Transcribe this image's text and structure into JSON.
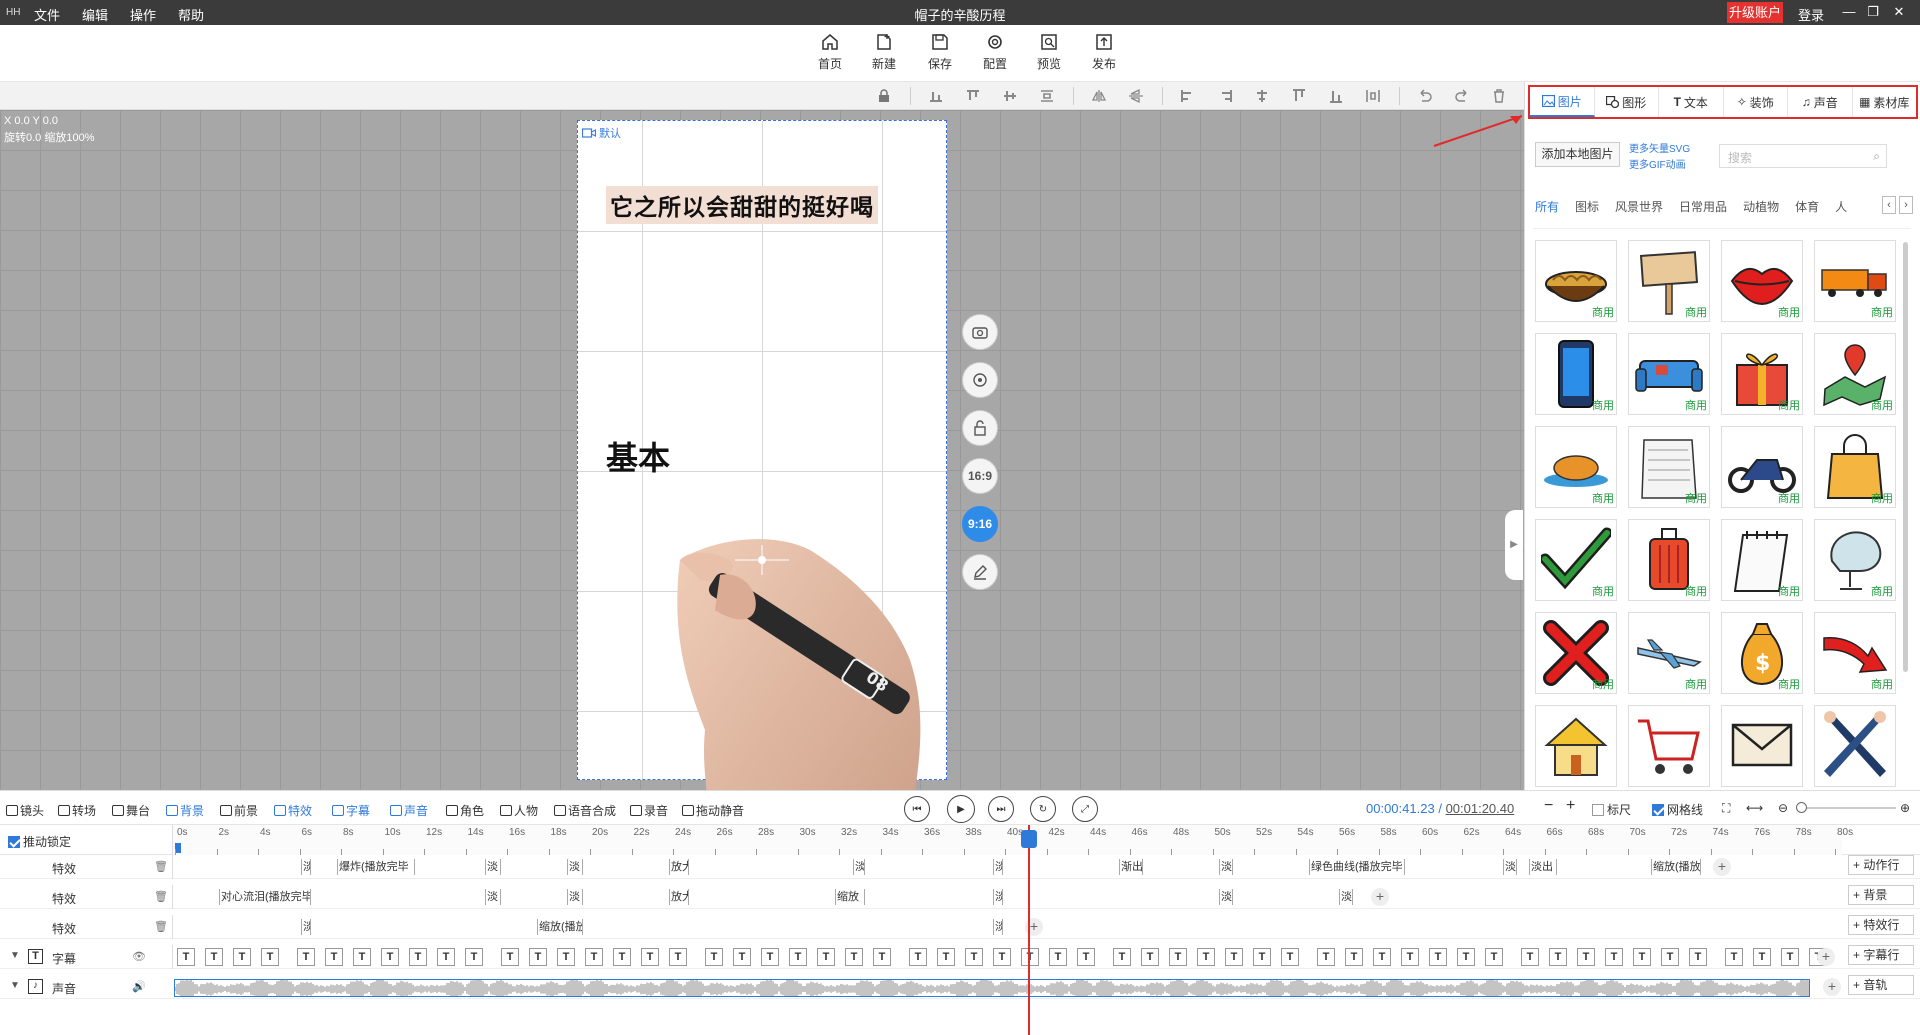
{
  "titlebar": {
    "logo": "HH",
    "menu": [
      "文件",
      "编辑",
      "操作",
      "帮助"
    ],
    "title": "帽子的辛酸历程",
    "upgrade": "升级账户",
    "login": "登录"
  },
  "toolbar": {
    "items": [
      "首页",
      "新建",
      "保存",
      "配置",
      "预览",
      "发布"
    ]
  },
  "canvas": {
    "coords": "X 0.0 Y 0.0",
    "rotate_zoom": "旋转0.0 缩放100%",
    "stage_tag": "默认",
    "text_line1": "它之所以会甜甜的挺好喝",
    "text_line2": "基本",
    "pen_label": "08",
    "side_buttons": {
      "ratio_169": "16:9",
      "ratio_916": "9:16"
    }
  },
  "right_panel": {
    "tabs": [
      "图片",
      "图形",
      "文本",
      "装饰",
      "声音",
      "素材库"
    ],
    "add_local": "添加本地图片",
    "link_svg": "更多矢量SVG",
    "link_gif": "更多GIF动画",
    "search_placeholder": "搜索",
    "categories": [
      "所有",
      "图标",
      "风景世界",
      "日常用品",
      "动植物",
      "体育",
      "人"
    ],
    "tag": "商用",
    "assets": [
      "noodles",
      "sign",
      "lips",
      "truck",
      "phone",
      "sofa",
      "gift",
      "map-pin",
      "roast-chicken",
      "paper-stack",
      "motorcycle",
      "shopping-bag",
      "check",
      "suitcase",
      "notepad",
      "chair",
      "cross",
      "airplane",
      "money-bag",
      "red-arrow",
      "house",
      "shopping-cart",
      "envelope",
      "crossed-arms"
    ]
  },
  "timeline": {
    "tools": [
      "镜头",
      "转场",
      "舞台",
      "背景",
      "前景",
      "特效",
      "字幕",
      "声音",
      "角色",
      "人物",
      "语音合成",
      "录音",
      "拖动静音"
    ],
    "current_time": "00:00:41.23",
    "separator": "/",
    "total_time": "00:01:20.40",
    "ruler_toggle": "标尺",
    "grid_toggle": "网格线",
    "lock_label": "推动锁定",
    "ticks": [
      "0s",
      "2s",
      "4s",
      "6s",
      "8s",
      "10s",
      "12s",
      "14s",
      "16s",
      "18s",
      "20s",
      "22s",
      "24s",
      "26s",
      "28s",
      "30s",
      "32s",
      "34s",
      "36s",
      "38s",
      "40s",
      "42s",
      "44s",
      "46s",
      "48s",
      "50s",
      "52s",
      "54s",
      "56s",
      "58s",
      "60s",
      "62s",
      "64s",
      "66s",
      "68s",
      "70s",
      "72s",
      "74s",
      "76s",
      "78s",
      "80s"
    ],
    "tracks": {
      "fx1": {
        "label": "特效",
        "clips": [
          "淡",
          "爆炸(播放完毕",
          "淡",
          "淡",
          "放大",
          "淡",
          "淡",
          "渐出",
          "淡",
          "绿色曲线(播放完毕",
          "淡",
          "淡出",
          "缩放(播放"
        ]
      },
      "fx2": {
        "label": "特效",
        "clips": [
          "对心流泪(播放完毕",
          "淡",
          "淡",
          "放大",
          "缩放",
          "淡",
          "淡",
          "淡"
        ]
      },
      "fx3": {
        "label": "特效",
        "clips": [
          "淡",
          "缩放(播放",
          "淡"
        ]
      },
      "subtitle": {
        "label": "字幕",
        "clip": "T"
      },
      "audio": {
        "label": "声音"
      }
    },
    "add_buttons": [
      "动作行",
      "背景",
      "特效行",
      "字幕行",
      "音轨"
    ]
  },
  "colors": {
    "accent": "#2f7ad8",
    "upgrade": "#e3322f",
    "commercial": "#1a9a3a",
    "highlight": "#e02b2b"
  }
}
